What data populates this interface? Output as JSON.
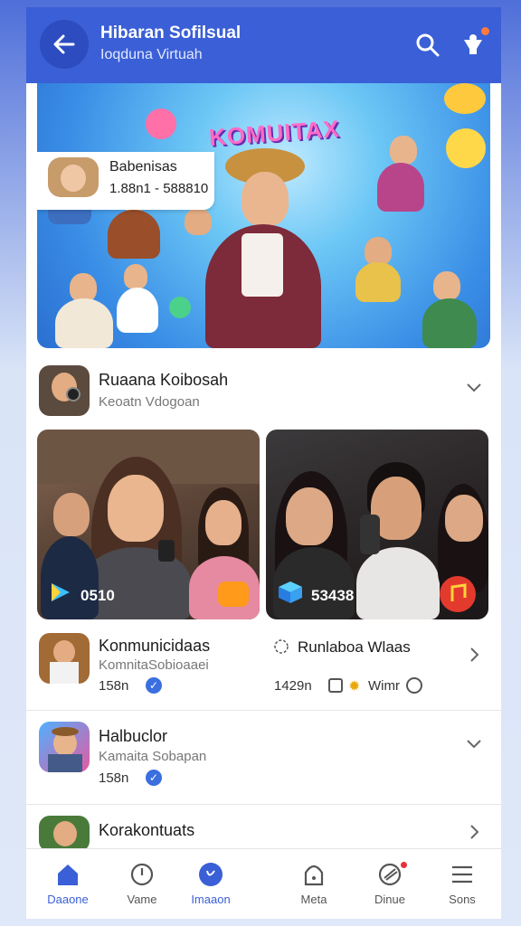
{
  "header": {
    "title": "Hibaran Sofilsual",
    "subtitle": "Ioqduna Virtuah",
    "back_icon": "arrow-left-icon",
    "search_icon": "search-icon",
    "notification_icon": "bell-icon"
  },
  "hero": {
    "banner_text": "KOMUITAX",
    "mini_card": {
      "name": "Babenisas",
      "meta": "1.88n1 - 588810"
    }
  },
  "room_header": {
    "title": "Ruaana Koibosah",
    "subtitle": "Keoatn Vdogoan"
  },
  "videos": [
    {
      "count": "0510",
      "icon": "play-icon"
    },
    {
      "count": "53438",
      "icon": "cube-icon"
    }
  ],
  "rows": [
    {
      "title": "Konmunicidaas",
      "subtitle": "KomnitaSobioaaei",
      "count": "158n",
      "right_title": "Runlaboa Wlaas",
      "right_meta": "1429n",
      "right_tag": "Wimr"
    },
    {
      "title": "Halbuclor",
      "subtitle": "Kamaita Sobapan",
      "count": "158n"
    },
    {
      "title": "Korakontuats",
      "subtitle": ""
    }
  ],
  "bottom_nav": [
    {
      "label": "Daaone",
      "icon": "home-icon",
      "active": true
    },
    {
      "label": "Vame",
      "icon": "compass-icon",
      "active": false
    },
    {
      "label": "Imaaon",
      "icon": "live-icon",
      "active": true
    },
    {
      "label": "Meta",
      "icon": "bag-icon",
      "active": false
    },
    {
      "label": "Dinue",
      "icon": "chat-icon",
      "active": false,
      "badge": true
    },
    {
      "label": "Sons",
      "icon": "menu-icon",
      "active": false
    }
  ],
  "colors": {
    "primary": "#3a5fd6",
    "header_bg": "#3a5fd6",
    "verified": "#3b6fe0",
    "badge": "#e9303a"
  }
}
